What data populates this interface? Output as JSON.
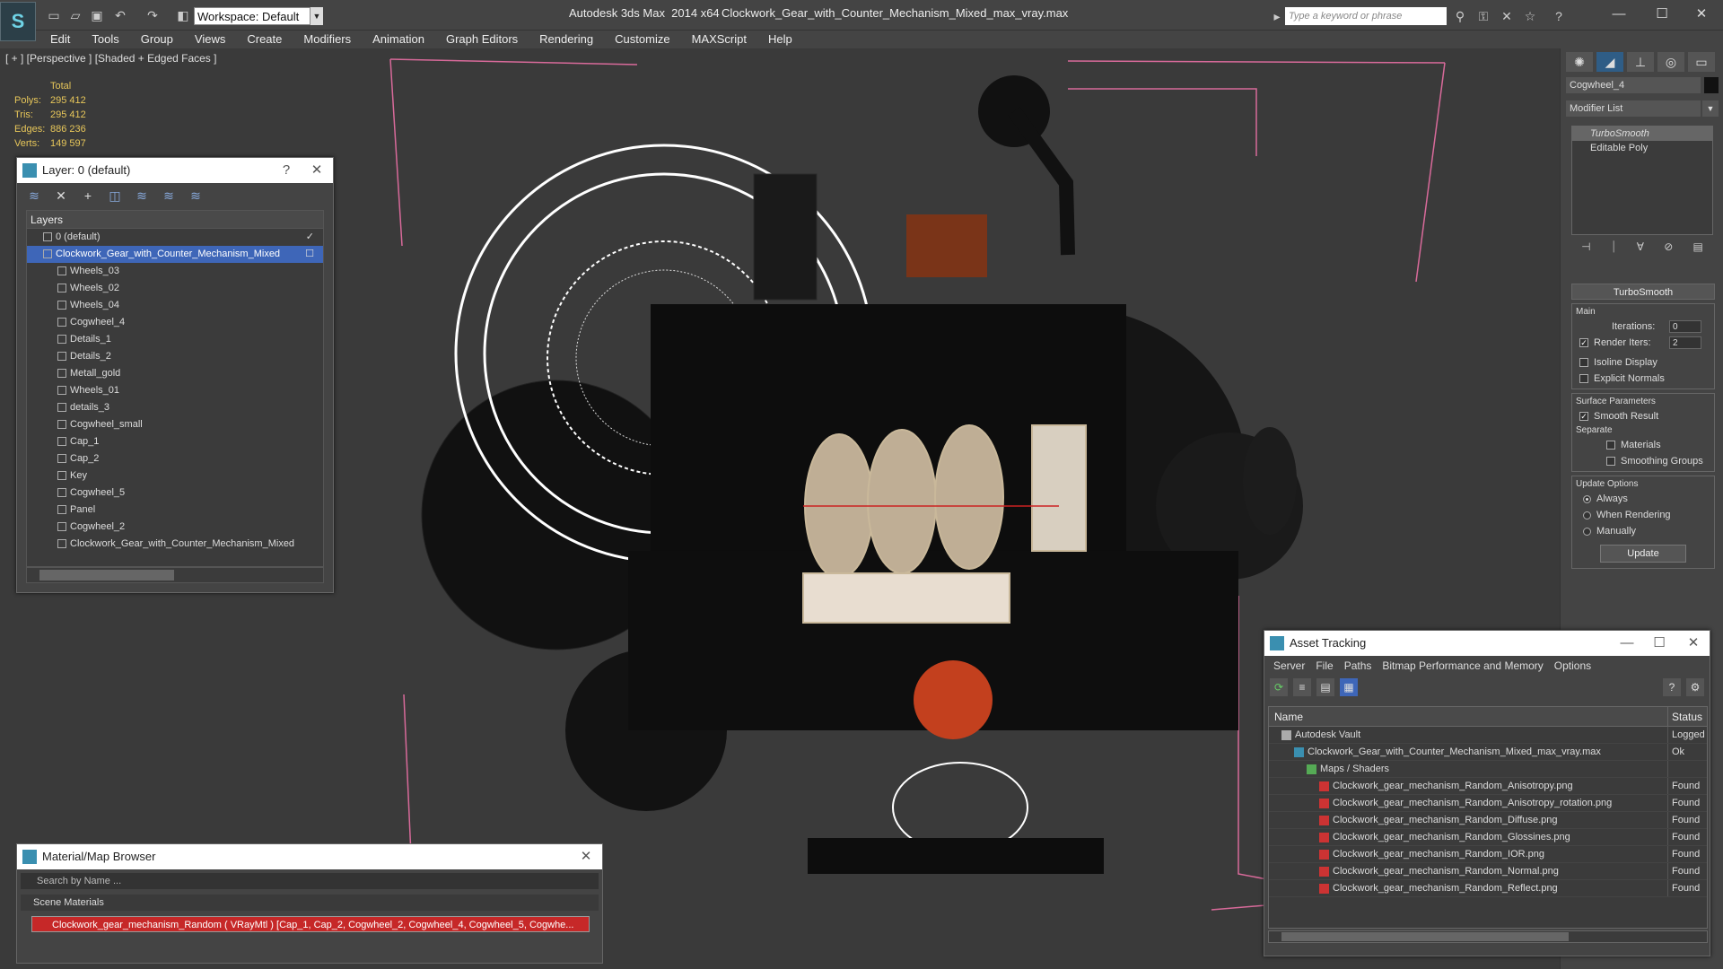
{
  "app": {
    "name": "Autodesk 3ds Max  2014 x64",
    "document": "Clockwork_Gear_with_Counter_Mechanism_Mixed_max_vray.max",
    "workspace": "Workspace: Default",
    "search_placeholder": "Type a keyword or phrase"
  },
  "menu": [
    "Edit",
    "Tools",
    "Group",
    "Views",
    "Create",
    "Modifiers",
    "Animation",
    "Graph Editors",
    "Rendering",
    "Customize",
    "MAXScript",
    "Help"
  ],
  "viewport": {
    "label": "[ + ] [Perspective ] [Shaded + Edged Faces ]",
    "stats": {
      "header": "Total",
      "rows": [
        {
          "label": "Polys:",
          "value": "295 412"
        },
        {
          "label": "Tris:",
          "value": "295 412"
        },
        {
          "label": "Edges:",
          "value": "886 236"
        },
        {
          "label": "Verts:",
          "value": "149 597"
        }
      ]
    }
  },
  "layer_window": {
    "title": "Layer: 0 (default)",
    "help": "?",
    "column": "Layers",
    "layers": [
      {
        "name": "0 (default)",
        "level": 1,
        "selected": false,
        "checked": true
      },
      {
        "name": "Clockwork_Gear_with_Counter_Mechanism_Mixed",
        "level": 1,
        "selected": true,
        "checked": false
      },
      {
        "name": "Wheels_03",
        "level": 2
      },
      {
        "name": "Wheels_02",
        "level": 2
      },
      {
        "name": "Wheels_04",
        "level": 2
      },
      {
        "name": "Cogwheel_4",
        "level": 2
      },
      {
        "name": "Details_1",
        "level": 2
      },
      {
        "name": "Details_2",
        "level": 2
      },
      {
        "name": "Metall_gold",
        "level": 2
      },
      {
        "name": "Wheels_01",
        "level": 2
      },
      {
        "name": "details_3",
        "level": 2
      },
      {
        "name": "Cogwheel_small",
        "level": 2
      },
      {
        "name": "Cap_1",
        "level": 2
      },
      {
        "name": "Cap_2",
        "level": 2
      },
      {
        "name": "Key",
        "level": 2
      },
      {
        "name": "Cogwheel_5",
        "level": 2
      },
      {
        "name": "Panel",
        "level": 2
      },
      {
        "name": "Cogwheel_2",
        "level": 2
      },
      {
        "name": "Clockwork_Gear_with_Counter_Mechanism_Mixed",
        "level": 2
      }
    ]
  },
  "material_browser": {
    "title": "Material/Map Browser",
    "search": "Search by Name ...",
    "section": "Scene Materials",
    "material": "Clockwork_gear_mechanism_Random  ( VRayMtl ) [Cap_1, Cap_2, Cogwheel_2, Cogwheel_4, Cogwheel_5, Cogwhe..."
  },
  "command_panel": {
    "object_name": "Cogwheel_4",
    "modifier_list": "Modifier List",
    "stack": [
      "TurboSmooth",
      "Editable Poly"
    ],
    "rollout_title": "TurboSmooth",
    "main_label": "Main",
    "iterations_label": "Iterations:",
    "iterations_value": "0",
    "render_iters_label": "Render Iters:",
    "render_iters_value": "2",
    "isoline": "Isoline Display",
    "explicit": "Explicit Normals",
    "surface_label": "Surface Parameters",
    "smooth_result": "Smooth Result",
    "separate_label": "Separate",
    "materials": "Materials",
    "smoothing_groups": "Smoothing Groups",
    "update_label": "Update Options",
    "always": "Always",
    "when_rendering": "When Rendering",
    "manually": "Manually",
    "update_button": "Update"
  },
  "asset_tracking": {
    "title": "Asset Tracking",
    "menu": [
      "Server",
      "File",
      "Paths",
      "Bitmap Performance and Memory",
      "Options"
    ],
    "col_name": "Name",
    "col_status": "Status",
    "rows": [
      {
        "name": "Autodesk Vault",
        "status": "Logged O",
        "indent": 1,
        "icon": "vault"
      },
      {
        "name": "Clockwork_Gear_with_Counter_Mechanism_Mixed_max_vray.max",
        "status": "Ok",
        "indent": 2,
        "icon": "max"
      },
      {
        "name": "Maps / Shaders",
        "status": "",
        "indent": 3,
        "icon": "folder"
      },
      {
        "name": "Clockwork_gear_mechanism_Random_Anisotropy.png",
        "status": "Found",
        "indent": 4,
        "icon": "png"
      },
      {
        "name": "Clockwork_gear_mechanism_Random_Anisotropy_rotation.png",
        "status": "Found",
        "indent": 4,
        "icon": "png"
      },
      {
        "name": "Clockwork_gear_mechanism_Random_Diffuse.png",
        "status": "Found",
        "indent": 4,
        "icon": "png"
      },
      {
        "name": "Clockwork_gear_mechanism_Random_Glossines.png",
        "status": "Found",
        "indent": 4,
        "icon": "png"
      },
      {
        "name": "Clockwork_gear_mechanism_Random_IOR.png",
        "status": "Found",
        "indent": 4,
        "icon": "png"
      },
      {
        "name": "Clockwork_gear_mechanism_Random_Normal.png",
        "status": "Found",
        "indent": 4,
        "icon": "png"
      },
      {
        "name": "Clockwork_gear_mechanism_Random_Reflect.png",
        "status": "Found",
        "indent": 4,
        "icon": "png"
      }
    ]
  }
}
